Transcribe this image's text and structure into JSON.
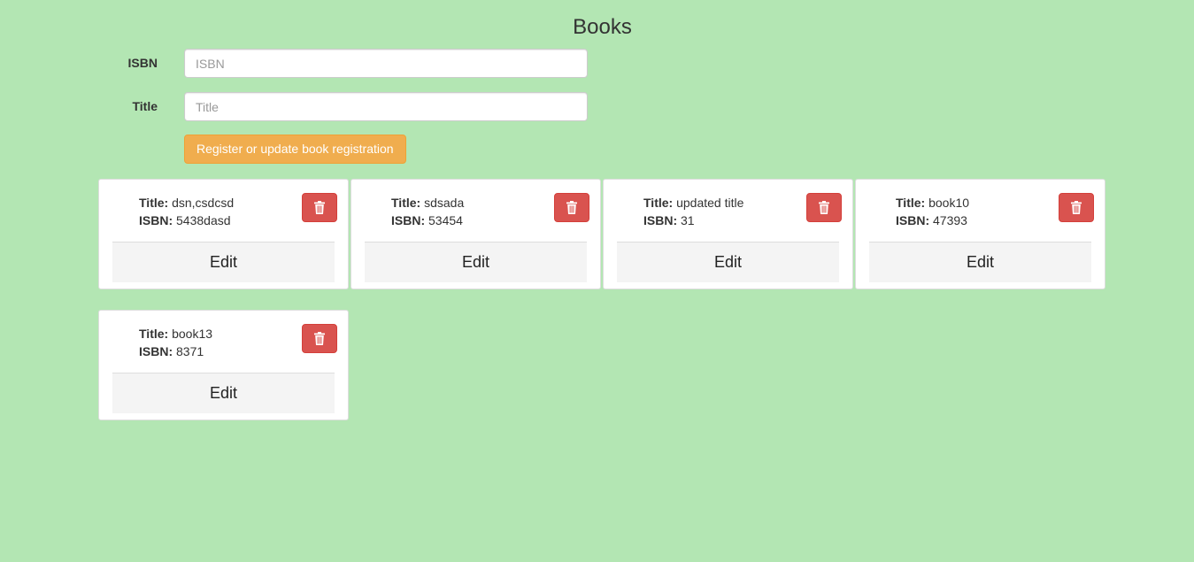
{
  "page": {
    "title": "Books"
  },
  "form": {
    "isbn_label": "ISBN",
    "isbn_value": "",
    "isbn_placeholder": "ISBN",
    "title_label": "Title",
    "title_value": "",
    "title_placeholder": "Title",
    "submit_label": "Register or update book registration"
  },
  "cards": [
    {
      "title_label": "Title:",
      "title": "dsn,csdcsd",
      "isbn_label": "ISBN:",
      "isbn": "5438dasd",
      "delete_icon": "trash-icon",
      "edit_label": "Edit"
    },
    {
      "title_label": "Title:",
      "title": "sdsada",
      "isbn_label": "ISBN:",
      "isbn": "53454",
      "delete_icon": "trash-icon",
      "edit_label": "Edit"
    },
    {
      "title_label": "Title:",
      "title": "updated title",
      "isbn_label": "ISBN:",
      "isbn": "31",
      "delete_icon": "trash-icon",
      "edit_label": "Edit"
    },
    {
      "title_label": "Title:",
      "title": "book10",
      "isbn_label": "ISBN:",
      "isbn": "47393",
      "delete_icon": "trash-icon",
      "edit_label": "Edit"
    },
    {
      "title_label": "Title:",
      "title": "book13",
      "isbn_label": "ISBN:",
      "isbn": "8371",
      "delete_icon": "trash-icon",
      "edit_label": "Edit"
    }
  ],
  "colors": {
    "background": "#b3e6b3",
    "primary_button": "#f0ad4e",
    "danger_button": "#d9534f",
    "edit_button": "#f4f4f4"
  }
}
